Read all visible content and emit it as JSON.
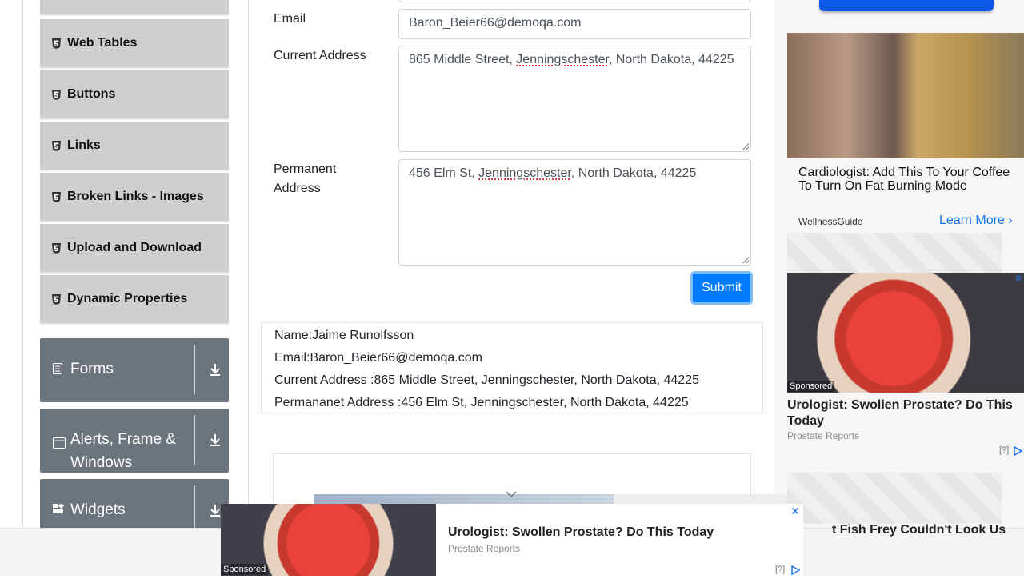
{
  "sidebar": {
    "elements_items": [
      {
        "label": "Web Tables"
      },
      {
        "label": "Buttons"
      },
      {
        "label": "Links"
      },
      {
        "label": "Broken Links - Images"
      },
      {
        "label": "Upload and Download"
      },
      {
        "label": "Dynamic Properties"
      }
    ],
    "groups": [
      {
        "label": "Forms"
      },
      {
        "label": "Alerts, Frame & Windows"
      },
      {
        "label": "Widgets"
      }
    ]
  },
  "form": {
    "email_label": "Email",
    "email_value": "Baron_Beier66@demoqa.com",
    "current_address_label": "Current Address",
    "current_address_pre": "865 Middle Street, ",
    "current_address_city": "Jenningschester",
    "current_address_post": ", North Dakota, 44225",
    "permanent_address_label": "Permanent Address",
    "permanent_address_pre": "456 Elm St, ",
    "permanent_address_city": "Jenningschester",
    "permanent_address_post": ", North Dakota, 44225",
    "submit_label": "Submit"
  },
  "output": {
    "name": "Name:Jaime Runolfsson",
    "email": "Email:Baron_Beier66@demoqa.com",
    "current_address": "Current Address :865 Middle Street, Jenningschester, North Dakota, 44225",
    "permanent_address": "Permananet Address :456 Elm St, Jenningschester, North Dakota, 44225"
  },
  "ads": {
    "right_top": {
      "title": "Cardiologist: Add This To Your Coffee To Turn On Fat Burning Mode",
      "source": "WellnessGuide",
      "cta": "Learn More"
    },
    "right_mid": {
      "sponsored": "Sponsored",
      "title": "Urologist: Swollen Prostate? Do This Today",
      "source": "Prostate Reports",
      "adchoice": "[?]"
    },
    "bottom": {
      "sponsored": "Sponsored",
      "title": "Urologist: Swollen Prostate? Do This Today",
      "source": "Prostate Reports",
      "adchoice": "[?]",
      "close": "✕",
      "cut_text": "t Fish Frey Couldn't Look Us"
    }
  },
  "colors": {
    "primary": "#007bff",
    "sidebar_item_bg": "#cfcfcf",
    "group_bg": "#6c757d",
    "link": "#1a73e8"
  }
}
